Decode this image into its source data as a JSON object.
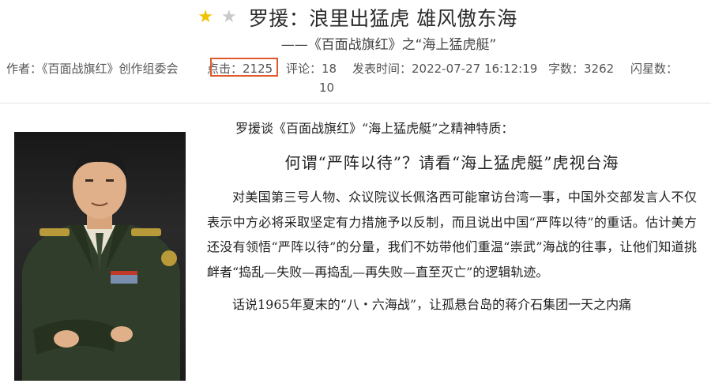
{
  "title": {
    "stars": [
      {
        "icon": "star-filled-icon",
        "color": "#f2c200"
      },
      {
        "icon": "star-outline-icon",
        "color": "#c9c9c9"
      }
    ],
    "text": "罗援：浪里出猛虎 雄风傲东海",
    "subtitle": "——《百面战旗红》之“海上猛虎艇”"
  },
  "meta": {
    "author": "作者：《百面战旗红》创作组委会",
    "clicks": "点击：2125",
    "comments": "评论：18",
    "published": "发表时间：2022-07-27 16:12:19",
    "word_count": "字数：3262",
    "flash_stars_label": "闪星数：",
    "flash_stars_value": "10",
    "highlight_color": "#e0582b"
  },
  "article": {
    "lead": "罗援谈《百面战旗红》“海上猛虎艇”之精神特质：",
    "headline": "何谓“严阵以待”？请看“海上猛虎艇”虎视台海",
    "paragraph1": "对美国第三号人物、众议院议长佩洛西可能窜访台湾一事，中国外交部发言人不仅表示中方必将采取坚定有力措施予以反制，而且说出中国“严阵以待”的重话。估计美方还没有领悟“严阵以待”的分量，我们不妨带他们重温“崇武”海战的往事，让他们知道挑衅者“捣乱—失败—再捣乱—再失败—直至灭亡”的逻辑轨迹。",
    "paragraph2": "话说1965年夏末的“八・六海战”，让孤悬台岛的蒋介石集团一天之内痛"
  },
  "photo": {
    "icon": "portrait-photo"
  }
}
